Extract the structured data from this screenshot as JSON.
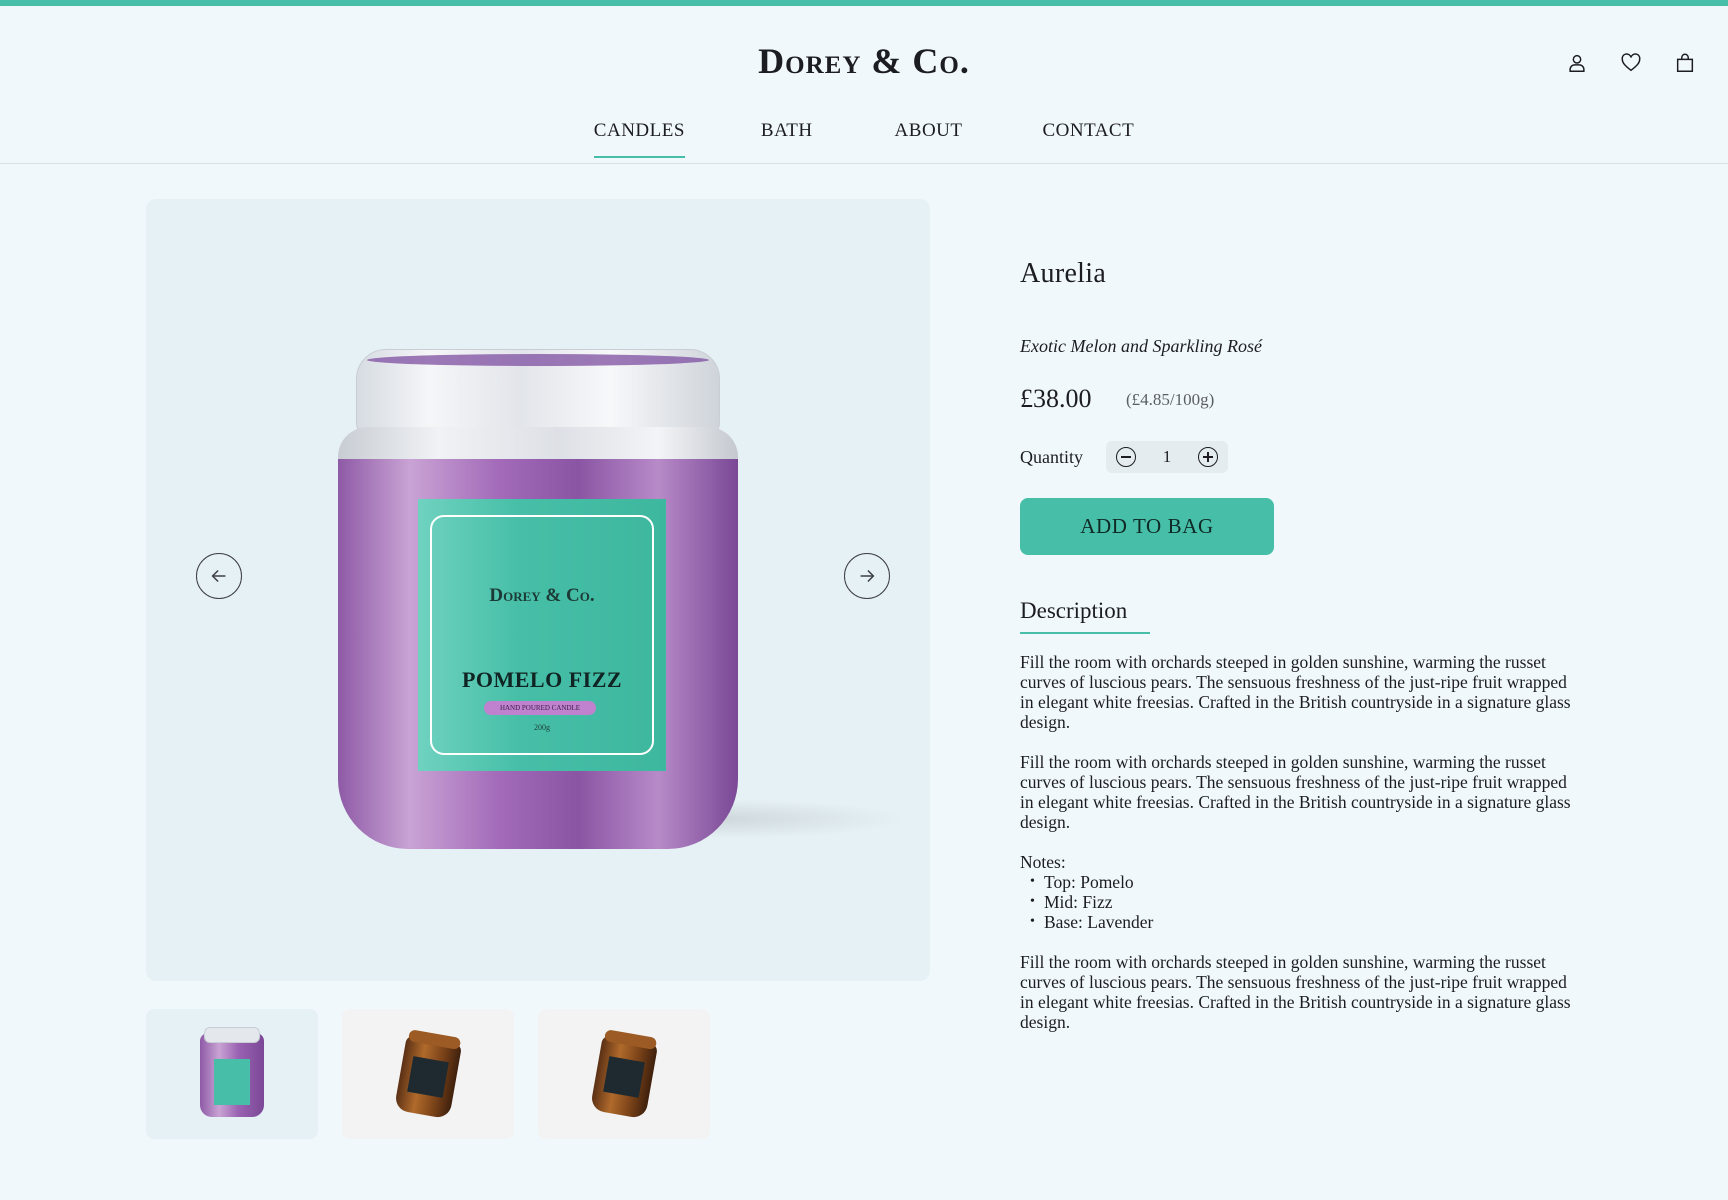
{
  "brand": {
    "logo": "Dorey & Co.",
    "accent_color": "#47bfa8"
  },
  "header": {
    "icons": [
      "user-icon",
      "heart-icon",
      "bag-icon"
    ]
  },
  "nav": {
    "items": [
      {
        "label": "CANDLES",
        "active": true
      },
      {
        "label": "BATH",
        "active": false
      },
      {
        "label": "ABOUT",
        "active": false
      },
      {
        "label": "CONTACT",
        "active": false
      }
    ]
  },
  "gallery": {
    "label_brand": "Dorey & Co.",
    "label_name": "POMELO FIZZ",
    "label_tag": "HAND POURED CANDLE",
    "label_weight": "200g",
    "prev_icon": "arrow-left-icon",
    "next_icon": "arrow-right-icon",
    "thumbnails": [
      {
        "name": "purple-jar",
        "active": true
      },
      {
        "name": "amber-jar",
        "active": false
      },
      {
        "name": "amber-jar",
        "active": false
      }
    ]
  },
  "product": {
    "name": "Aurelia",
    "subtitle": "Exotic Melon and Sparkling Rosé",
    "price": "£38.00",
    "unit_price": "(£4.85/100g)",
    "quantity_label": "Quantity",
    "quantity": "1",
    "add_to_bag": "ADD TO BAG"
  },
  "description": {
    "heading": "Description",
    "paragraph_1": "Fill the room with orchards steeped in golden sunshine, warming the russet curves of luscious pears. The sensuous freshness of the just-ripe fruit wrapped in elegant white freesias. Crafted in the British countryside in a signature glass design.",
    "paragraph_2": "Fill the room with orchards steeped in golden sunshine, warming the russet curves of luscious pears. The sensuous freshness of the just-ripe fruit wrapped in elegant white freesias. Crafted in the British countryside in a signature glass design.",
    "notes_label": "Notes:",
    "notes": [
      "Top: Pomelo",
      "Mid: Fizz",
      "Base: Lavender"
    ],
    "paragraph_3": "Fill the room with orchards steeped in golden sunshine, warming the russet curves of luscious pears. The sensuous freshness of the just-ripe fruit wrapped in elegant white freesias. Crafted in the British countryside in a signature glass design."
  }
}
